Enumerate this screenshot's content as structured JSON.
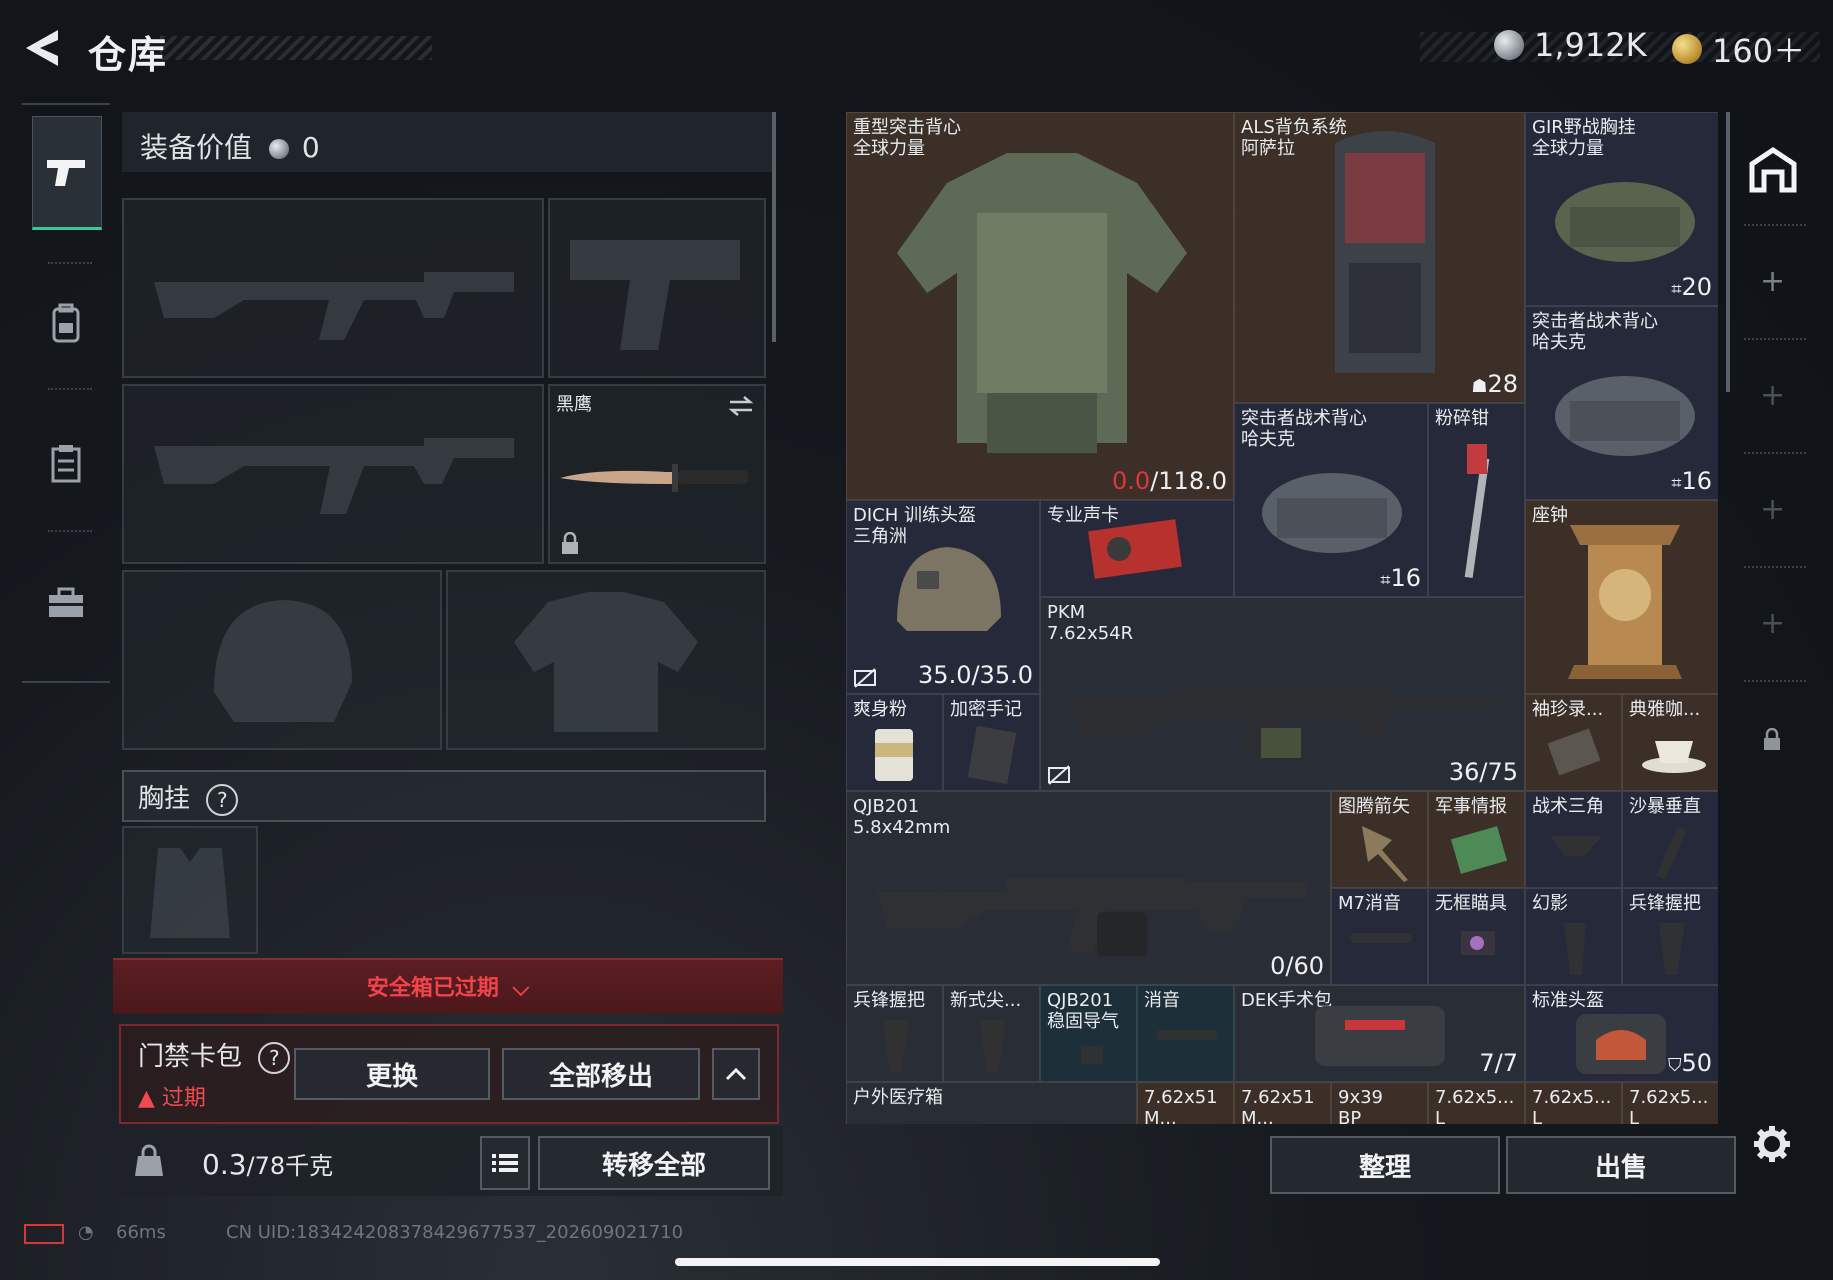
{
  "header": {
    "title": "仓库",
    "silver": "1,912K",
    "gold": "160＋",
    "tiny_text": ""
  },
  "loadout": {
    "value_label": "装备价值",
    "value": "0",
    "knife_name": "黑鹰",
    "chest_label": "胸挂",
    "chest_help": "?",
    "safe_box_status": "安全箱已过期",
    "card_pack_label": "门禁卡包",
    "card_pack_help": "?",
    "card_pack_status": "过期",
    "replace_button": "更换",
    "move_all_out_button": "全部移出",
    "weight_value": "0.3",
    "weight_cap": "/78千克",
    "transfer_all_button": "转移全部"
  },
  "footer": {
    "ping": "66ms",
    "uid": "CN UID:1834242083784296775​37_202609021710"
  },
  "stash": {
    "sort_button": "整理",
    "sell_button": "出售",
    "items": [
      {
        "id": "heavy-assault-vest",
        "name": "重型突击背心\n全球力量",
        "count_red": "0.0",
        "count": "/118.0"
      },
      {
        "id": "als-backpack",
        "name": "ALS背负系统\n阿萨拉",
        "count": "28"
      },
      {
        "id": "gir-chest-rig",
        "name": "GIR野战胸挂\n全球力量",
        "count": "20"
      },
      {
        "id": "assault-vest-hk-1",
        "name": "突击者战术背心\n哈夫克",
        "count": "16"
      },
      {
        "id": "assault-vest-hk-2",
        "name": "突击者战术背心\n哈夫克",
        "count": "16"
      },
      {
        "id": "wrench",
        "name": "粉碎钳"
      },
      {
        "id": "dich-helmet",
        "name": "DICH 训练头盔\n三角洲",
        "count": "35.0/35.0"
      },
      {
        "id": "pro-graphics-card",
        "name": "专业声卡"
      },
      {
        "id": "clock",
        "name": "座钟"
      },
      {
        "id": "pkm",
        "name": "PKM\n7.62x54R",
        "count": "36/75"
      },
      {
        "id": "powder",
        "name": "爽身粉"
      },
      {
        "id": "secret-notes",
        "name": "加密手记"
      },
      {
        "id": "pocket-record",
        "name": "袖珍录..."
      },
      {
        "id": "elegant-cup",
        "name": "典雅咖..."
      },
      {
        "id": "qjb201",
        "name": "QJB201\n5.8x42mm",
        "count": "0/60"
      },
      {
        "id": "totem-arrow",
        "name": "图腾箭矢"
      },
      {
        "id": "mil-intel",
        "name": "军事情报"
      },
      {
        "id": "tactical-triangle",
        "name": "战术三角"
      },
      {
        "id": "sandstorm-grip",
        "name": "沙暴垂直"
      },
      {
        "id": "m7-suppressor",
        "name": "M7消音"
      },
      {
        "id": "frameless-sight",
        "name": "无框瞄具"
      },
      {
        "id": "phantom",
        "name": "幻影"
      },
      {
        "id": "vanguard-grip-1",
        "name": "兵锋握把"
      },
      {
        "id": "vanguard-grip-2",
        "name": "兵锋握把"
      },
      {
        "id": "new-tip",
        "name": "新式尖..."
      },
      {
        "id": "qjb201-stabilizer",
        "name": "QJB201\n稳固导气"
      },
      {
        "id": "suppressor",
        "name": "消音"
      },
      {
        "id": "dek-kit",
        "name": "DEK手术包",
        "count": "7/7"
      },
      {
        "id": "std-helmet",
        "name": "标准头盔",
        "count": "50"
      },
      {
        "id": "outdoor-kit",
        "name": "户外医疗箱"
      },
      {
        "id": "ammo-1",
        "name": "7.62x51\nM..."
      },
      {
        "id": "ammo-2",
        "name": "7.62x51\nM..."
      },
      {
        "id": "ammo-3",
        "name": "9x39\nBP"
      },
      {
        "id": "ammo-4",
        "name": "7.62x5...\nL"
      },
      {
        "id": "ammo-5",
        "name": "7.62x5...\nL"
      },
      {
        "id": "ammo-6",
        "name": "7.62x5...\nL"
      }
    ]
  }
}
